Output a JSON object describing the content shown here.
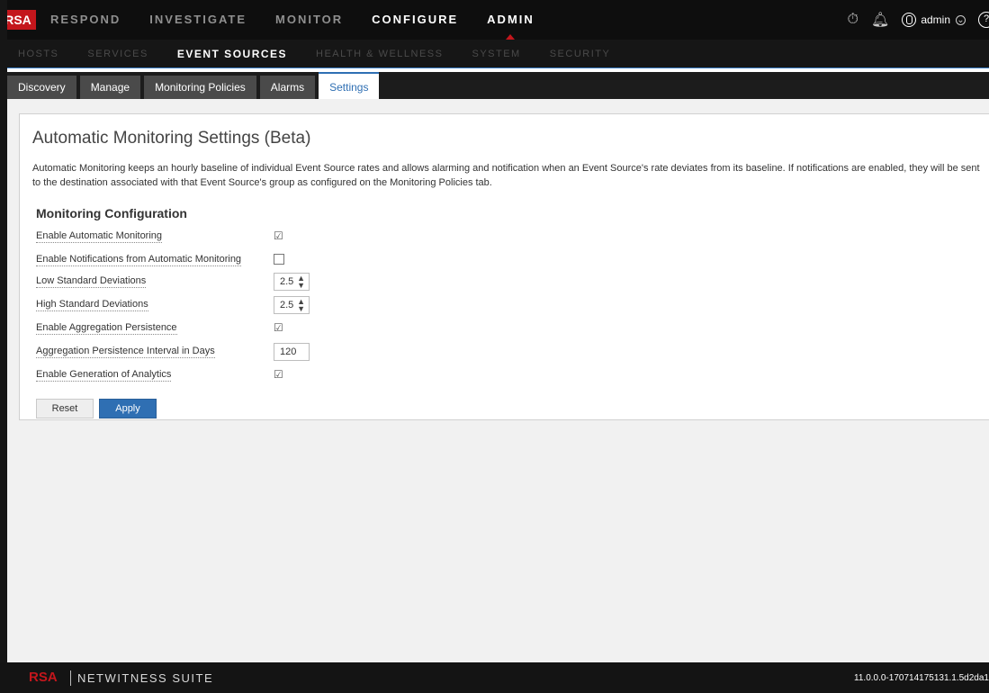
{
  "topnav": {
    "logo": "RSA",
    "items": [
      {
        "label": "RESPOND"
      },
      {
        "label": "INVESTIGATE"
      },
      {
        "label": "MONITOR"
      },
      {
        "label": "CONFIGURE"
      },
      {
        "label": "ADMIN"
      }
    ],
    "active": "ADMIN",
    "user": "admin",
    "icons": [
      "stopwatch-icon",
      "bell-icon",
      "user-icon",
      "help-icon"
    ]
  },
  "subnav": {
    "items": [
      {
        "label": "HOSTS"
      },
      {
        "label": "SERVICES"
      },
      {
        "label": "EVENT SOURCES"
      },
      {
        "label": "HEALTH & WELLNESS"
      },
      {
        "label": "SYSTEM"
      },
      {
        "label": "SECURITY"
      }
    ],
    "active": "EVENT SOURCES"
  },
  "tabs": {
    "items": [
      {
        "label": "Discovery"
      },
      {
        "label": "Manage"
      },
      {
        "label": "Monitoring Policies"
      },
      {
        "label": "Alarms"
      },
      {
        "label": "Settings"
      }
    ],
    "active": "Settings"
  },
  "page": {
    "title": "Automatic Monitoring Settings (Beta)",
    "description": "Automatic Monitoring keeps an hourly baseline of individual Event Source rates and allows alarming and notification when an Event Source's rate deviates from its baseline. If notifications are enabled, they will be sent to the destination associated with that Event Source's group as configured on the Monitoring Policies tab.",
    "section_title": "Monitoring Configuration",
    "settings": {
      "enable_auto_monitoring": {
        "label": "Enable Automatic Monitoring",
        "checked": true
      },
      "enable_notifications": {
        "label": "Enable Notifications from Automatic Monitoring",
        "checked": false
      },
      "low_std_dev": {
        "label": "Low Standard Deviations",
        "value": "2.5"
      },
      "high_std_dev": {
        "label": "High Standard Deviations",
        "value": "2.5"
      },
      "enable_agg_persistence": {
        "label": "Enable Aggregation Persistence",
        "checked": true
      },
      "agg_persistence_interval": {
        "label": "Aggregation Persistence Interval in Days",
        "value": "120"
      },
      "enable_analytics": {
        "label": "Enable Generation of Analytics",
        "checked": true
      }
    },
    "reset_label": "Reset",
    "apply_label": "Apply"
  },
  "footer": {
    "logo": "RSA",
    "brand": "NETWITNESS SUITE",
    "version": "11.0.0.0-170714175131.1.5d2da1"
  },
  "colors": {
    "accent": "#2f6fb3",
    "brand_red": "#c4161c",
    "nav_bg": "#0e0e0e"
  }
}
